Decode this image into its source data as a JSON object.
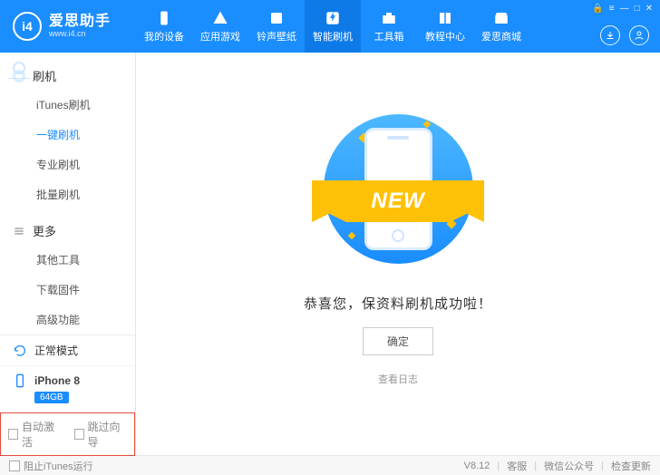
{
  "brand": {
    "name": "爱思助手",
    "url": "www.i4.cn",
    "logo": "i4"
  },
  "nav": [
    {
      "label": "我的设备"
    },
    {
      "label": "应用游戏"
    },
    {
      "label": "铃声壁纸"
    },
    {
      "label": "智能刷机"
    },
    {
      "label": "工具箱"
    },
    {
      "label": "教程中心"
    },
    {
      "label": "爱思商城"
    }
  ],
  "sidebar": {
    "group1": {
      "title": "刷机",
      "items": [
        "iTunes刷机",
        "一键刷机",
        "专业刷机",
        "批量刷机"
      ],
      "active": 1
    },
    "group2": {
      "title": "更多",
      "items": [
        "其他工具",
        "下载固件",
        "高级功能"
      ]
    }
  },
  "status": {
    "mode": "正常模式",
    "device": "iPhone 8",
    "storage": "64GB"
  },
  "options": {
    "auto_activate": "自动激活",
    "skip_wizard": "跳过向导"
  },
  "content": {
    "ribbon": "NEW",
    "message": "恭喜您，保资料刷机成功啦！",
    "ok": "确定",
    "log": "查看日志"
  },
  "footer": {
    "block_itunes": "阻止iTunes运行",
    "version": "V8.12",
    "support": "客服",
    "wechat": "微信公众号",
    "update": "检查更新"
  }
}
